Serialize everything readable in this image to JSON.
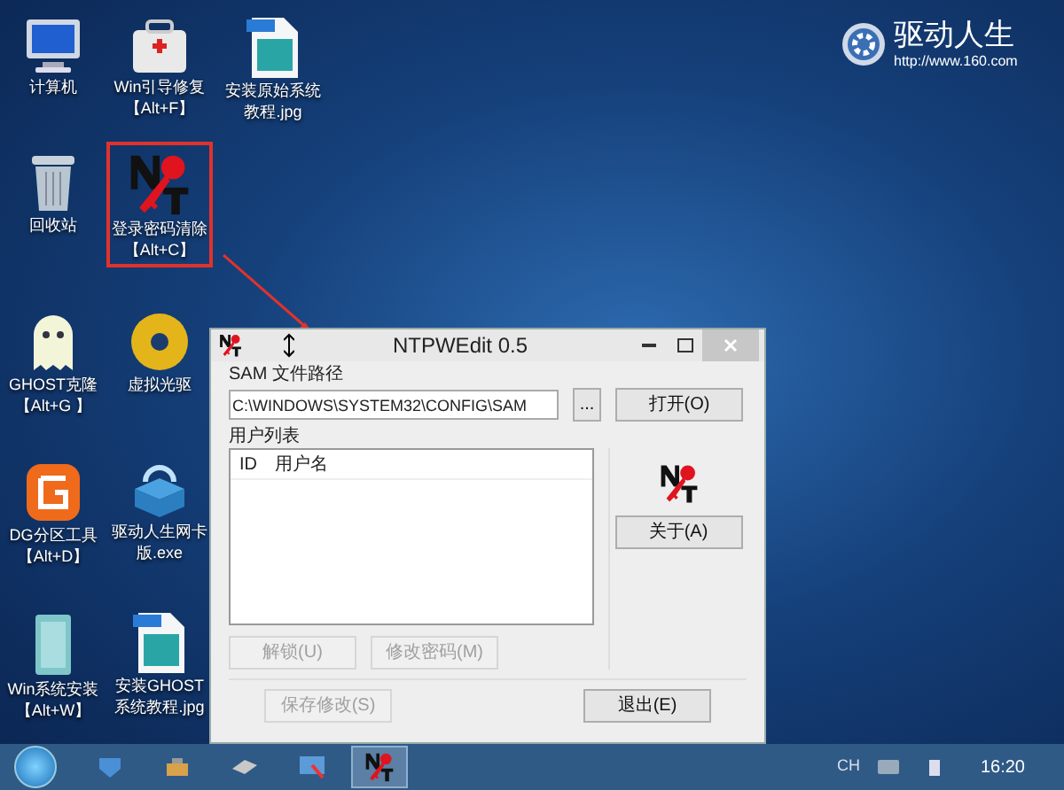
{
  "brand": {
    "name": "驱动人生",
    "url": "http://www.160.com"
  },
  "desktop_icons": [
    {
      "kind": "computer",
      "lines": [
        "计算机"
      ],
      "selected": false
    },
    {
      "kind": "toolbox",
      "lines": [
        "Win引导修复",
        "【Alt+F】"
      ],
      "selected": false
    },
    {
      "kind": "jpg",
      "lines": [
        "安装原始系统",
        "教程.jpg"
      ],
      "selected": false
    },
    {
      "kind": "recycle",
      "lines": [
        "回收站"
      ],
      "selected": false
    },
    {
      "kind": "ntkey",
      "lines": [
        "登录密码清除",
        "【Alt+C】"
      ],
      "selected": true
    },
    {
      "kind": "ghost",
      "lines": [
        "GHOST克隆",
        "【Alt+G 】"
      ],
      "selected": false
    },
    {
      "kind": "disc",
      "lines": [
        "虚拟光驱"
      ],
      "selected": false
    },
    {
      "kind": "dg",
      "lines": [
        "DG分区工具",
        "【Alt+D】"
      ],
      "selected": false
    },
    {
      "kind": "cloud",
      "lines": [
        "驱动人生网卡",
        "版.exe"
      ],
      "selected": false
    },
    {
      "kind": "installer",
      "lines": [
        "Win系统安装",
        "【Alt+W】"
      ],
      "selected": false
    },
    {
      "kind": "jpg",
      "lines": [
        "安装GHOST",
        "系统教程.jpg"
      ],
      "selected": false
    }
  ],
  "window": {
    "title": "NTPWEdit 0.5",
    "sam_label": "SAM 文件路径",
    "sam_path": "C:\\WINDOWS\\SYSTEM32\\CONFIG\\SAM",
    "browse_button": "...",
    "open_button": "打开(O)",
    "user_list_label": "用户列表",
    "columns": [
      "ID",
      "用户名"
    ],
    "about_button": "关于(A)",
    "unlock_button": {
      "label": "解锁(U)",
      "disabled": true
    },
    "change_password_button": {
      "label": "修改密码(M)",
      "disabled": true
    },
    "save_button": {
      "label": "保存修改(S)",
      "disabled": true
    },
    "exit_button": {
      "label": "退出(E)",
      "disabled": false
    }
  },
  "taskbar": {
    "apps": [
      {
        "kind": "shield",
        "active": false
      },
      {
        "kind": "tools",
        "active": false
      },
      {
        "kind": "drive",
        "active": false
      },
      {
        "kind": "monitor",
        "active": false
      },
      {
        "kind": "ntkey",
        "active": true
      }
    ],
    "language": "CH",
    "clock": "16:20"
  }
}
